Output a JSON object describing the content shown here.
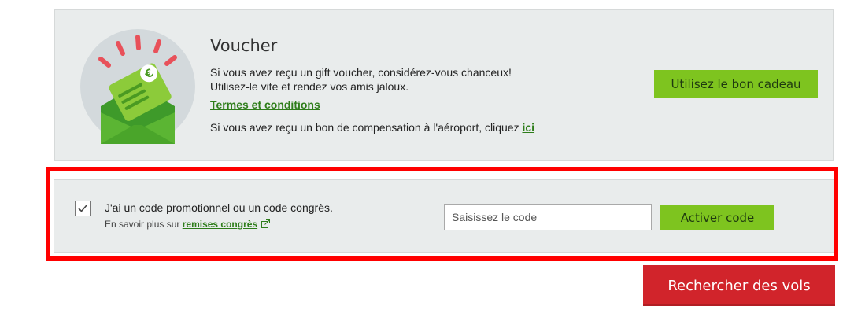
{
  "voucher": {
    "title": "Voucher",
    "line1": "Si vous avez reçu un gift voucher, considérez-vous chanceux!",
    "line2": "Utilisez-le vite et rendez vos amis jaloux.",
    "terms_link": "Termes et conditions",
    "airport_text": "Si vous avez reçu un bon de compensation à l'aéroport, cliquez ",
    "airport_link": "ici",
    "use_button": "Utilisez le bon cadeau",
    "illustration_icon": "gift-voucher-envelope-icon",
    "currency_symbol": "€"
  },
  "promo": {
    "checkbox_checked": true,
    "label": "J'ai un code promotionnel ou un code congrès.",
    "learn_more_prefix": "En savoir plus sur ",
    "learn_more_link": "remises congrès",
    "code_placeholder": "Saisissez le code",
    "activate_button": "Activer code"
  },
  "search_button": "Rechercher des vols",
  "colors": {
    "accent_green": "#7ec41f",
    "link_green": "#2e7d1a",
    "search_red": "#d1242b",
    "highlight_red": "#ff0000",
    "panel_bg": "#e9ecec"
  }
}
